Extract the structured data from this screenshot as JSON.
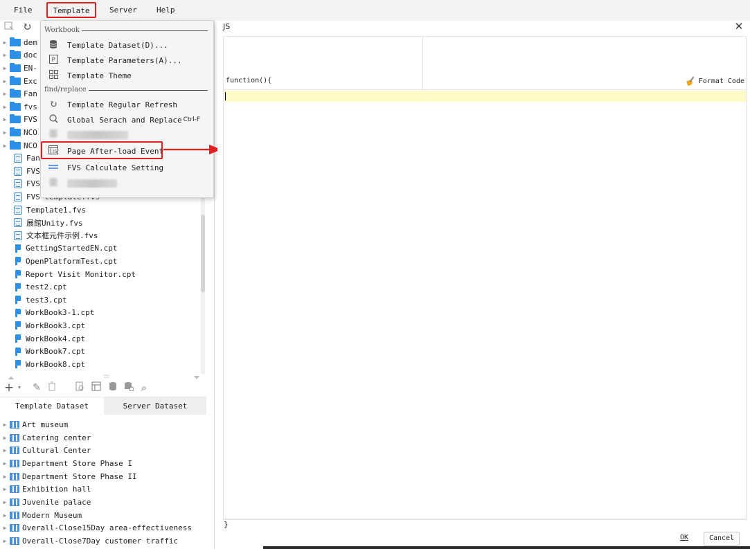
{
  "menubar": {
    "file": "File",
    "template": "Template",
    "server": "Server",
    "help": "Help"
  },
  "file_tree": [
    {
      "label": "dem",
      "type": "folder"
    },
    {
      "label": "doc",
      "type": "folder"
    },
    {
      "label": "EN-",
      "type": "folder"
    },
    {
      "label": "Exc",
      "type": "folder"
    },
    {
      "label": "Fan",
      "type": "folder"
    },
    {
      "label": "fvs",
      "type": "folder"
    },
    {
      "label": "FVS",
      "type": "folder"
    },
    {
      "label": "NCO",
      "type": "folder"
    },
    {
      "label": "NCO",
      "type": "folder"
    },
    {
      "label": "Fan",
      "type": "fvs"
    },
    {
      "label": "FVS",
      "type": "fvs"
    },
    {
      "label": "FVS",
      "type": "fvs"
    },
    {
      "label": "FVS template.fvs",
      "type": "fvs"
    },
    {
      "label": "Template1.fvs",
      "type": "fvs"
    },
    {
      "label": "展館Unity.fvs",
      "type": "fvs"
    },
    {
      "label": "文本框元件示例.fvs",
      "type": "fvs"
    },
    {
      "label": "GettingStartedEN.cpt",
      "type": "cpt"
    },
    {
      "label": "OpenPlatformTest.cpt",
      "type": "cpt"
    },
    {
      "label": "Report Visit Monitor.cpt",
      "type": "cpt"
    },
    {
      "label": "test2.cpt",
      "type": "cpt"
    },
    {
      "label": "test3.cpt",
      "type": "cpt"
    },
    {
      "label": "WorkBook3-1.cpt",
      "type": "cpt"
    },
    {
      "label": "WorkBook3.cpt",
      "type": "cpt"
    },
    {
      "label": "WorkBook4.cpt",
      "type": "cpt"
    },
    {
      "label": "WorkBook7.cpt",
      "type": "cpt"
    },
    {
      "label": "WorkBook8.cpt",
      "type": "cpt"
    }
  ],
  "dataset_tabs": {
    "template": "Template Dataset",
    "server": "Server Dataset"
  },
  "datasets": [
    "Art museum",
    "Catering center",
    "Cultural Center",
    "Department Store Phase I",
    "Department Store Phase II",
    "Exhibition hall",
    "Juvenile palace",
    "Modern Museum",
    "Overall-Close15Day area-effectiveness",
    "Overall-Close7Day customer traffic"
  ],
  "dropdown": {
    "section_workbook": "Workbook",
    "template_dataset": "Template Dataset(D)...",
    "template_parameters": "Template Parameters(A)...",
    "template_theme": "Template Theme",
    "section_find": "find/replace",
    "regular_refresh": "Template Regular Refresh",
    "global_search": "Global Serach and Replace",
    "global_search_shortcut": "Ctrl-F",
    "page_after_load": "Page After-load Event",
    "fvs_calc": "FVS Calculate Setting"
  },
  "dialog": {
    "title": "JS",
    "fn_open": "function(){",
    "fn_close": "}",
    "format_code": "Format Code",
    "ok": "OK",
    "cancel": "Cancel"
  },
  "colors": {
    "highlight_red": "#e02020",
    "folder_blue": "#2e8fe6",
    "current_line": "#fefbc8"
  }
}
